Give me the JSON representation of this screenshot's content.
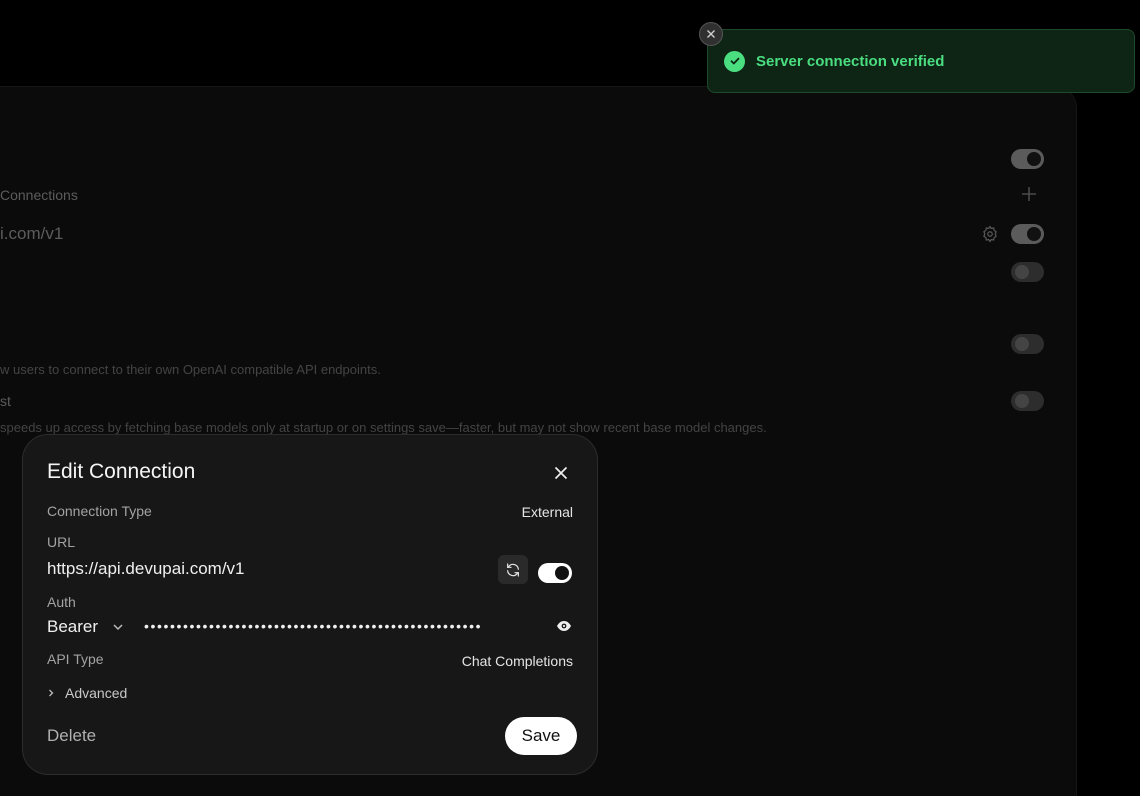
{
  "background": {
    "section_label": "Connections",
    "connection_url_partial": "i.com/v1",
    "direct_connections_desc_partial": "w users to connect to their own OpenAI compatible API endpoints.",
    "cache_label_partial": "st",
    "cache_desc_partial": "speeds up access by fetching base models only at startup or on settings save—faster, but may not show recent base model changes."
  },
  "toast": {
    "message": "Server connection verified"
  },
  "modal": {
    "title": "Edit Connection",
    "connection_type_label": "Connection Type",
    "connection_type_value": "External",
    "url_label": "URL",
    "url_value": "https://api.devupai.com/v1",
    "auth_label": "Auth",
    "auth_type": "Bearer",
    "api_key_masked": "••••••••••••••••••••••••••••••••••••••••••••••••••••",
    "api_type_label": "API Type",
    "api_type_value": "Chat Completions",
    "advanced_label": "Advanced",
    "delete_label": "Delete",
    "save_label": "Save"
  },
  "colors": {
    "toast_accent": "#4ade80",
    "toast_bg": "#0e2415",
    "modal_bg": "#171717"
  }
}
